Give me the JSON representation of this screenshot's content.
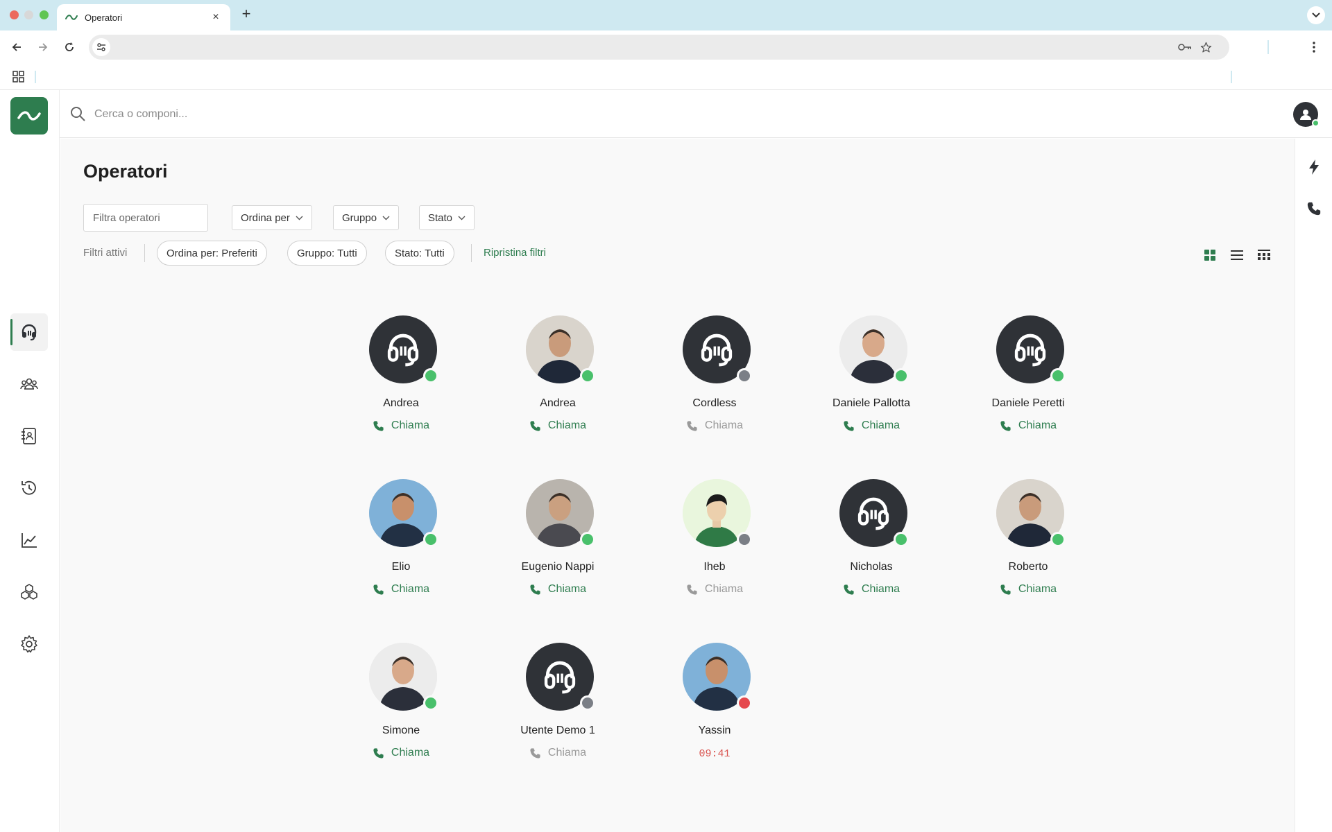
{
  "browser": {
    "tab_title": "Operatori",
    "url": ""
  },
  "search": {
    "placeholder": "Cerca o componi..."
  },
  "page": {
    "title": "Operatori",
    "filter_placeholder": "Filtra operatori",
    "dropdowns": [
      "Ordina per",
      "Gruppo",
      "Stato"
    ],
    "active_filters_label": "Filtri attivi",
    "chips": [
      "Ordina per: Preferiti",
      "Gruppo: Tutti",
      "Stato: Tutti"
    ],
    "reset_label": "Ripristina filtri"
  },
  "sidebar": {
    "items": [
      {
        "icon": "headset-icon",
        "active": true
      },
      {
        "icon": "users-icon",
        "active": false
      },
      {
        "icon": "phonebook-icon",
        "active": false
      },
      {
        "icon": "history-icon",
        "active": false
      },
      {
        "icon": "chart-icon",
        "active": false
      },
      {
        "icon": "apps-icon",
        "active": false
      },
      {
        "icon": "settings-icon",
        "active": false
      }
    ]
  },
  "rightbar": {
    "items": [
      {
        "icon": "lightning-icon"
      },
      {
        "icon": "phone-icon"
      }
    ]
  },
  "status_colors": {
    "online": "#49c06b",
    "offline": "#7b7f86",
    "busy": "#e5484d"
  },
  "colors": {
    "accent": "#2e7d4f",
    "call_disabled": "#9a9a9a",
    "timer": "#d9534f"
  },
  "operators": [
    {
      "name": "Andrea",
      "avatar": "headset",
      "status": "online",
      "action": "Chiama",
      "enabled": true
    },
    {
      "name": "Andrea",
      "avatar": "photo",
      "status": "online",
      "action": "Chiama",
      "enabled": true
    },
    {
      "name": "Cordless",
      "avatar": "headset",
      "status": "offline",
      "action": "Chiama",
      "enabled": false
    },
    {
      "name": "Daniele Pallotta",
      "avatar": "photo",
      "status": "online",
      "action": "Chiama",
      "enabled": true
    },
    {
      "name": "Daniele Peretti",
      "avatar": "headset",
      "status": "online",
      "action": "Chiama",
      "enabled": true
    },
    {
      "name": "Elio",
      "avatar": "photo",
      "status": "online",
      "action": "Chiama",
      "enabled": true
    },
    {
      "name": "Eugenio Nappi",
      "avatar": "photo",
      "status": "online",
      "action": "Chiama",
      "enabled": true
    },
    {
      "name": "Iheb",
      "avatar": "illustration",
      "status": "offline",
      "action": "Chiama",
      "enabled": false
    },
    {
      "name": "Nicholas",
      "avatar": "headset",
      "status": "online",
      "action": "Chiama",
      "enabled": true
    },
    {
      "name": "Roberto",
      "avatar": "photo",
      "status": "online",
      "action": "Chiama",
      "enabled": true
    },
    {
      "name": "Simone",
      "avatar": "photo",
      "status": "online",
      "action": "Chiama",
      "enabled": true
    },
    {
      "name": "Utente Demo 1",
      "avatar": "headset",
      "status": "offline",
      "action": "Chiama",
      "enabled": false
    },
    {
      "name": "Yassin",
      "avatar": "photo",
      "status": "busy",
      "action": "",
      "timer": "09:41",
      "enabled": false
    }
  ]
}
